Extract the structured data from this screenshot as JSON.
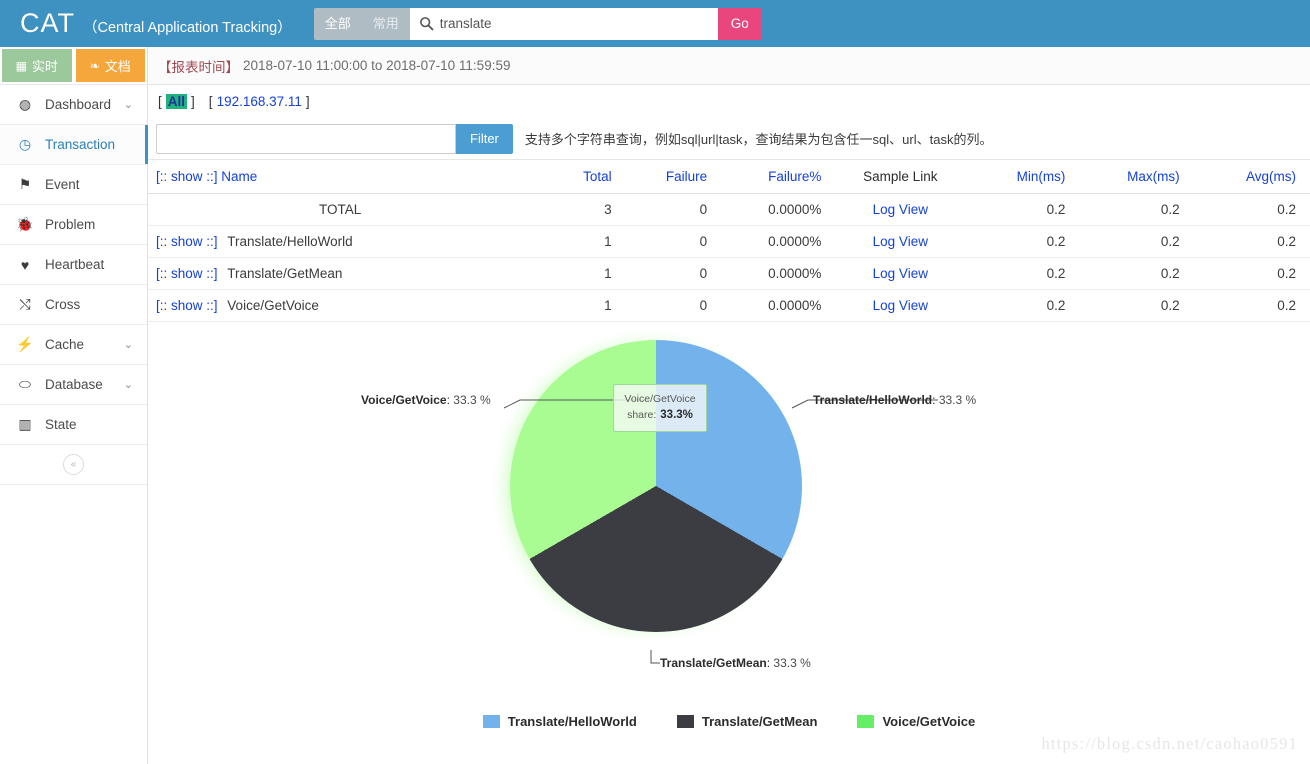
{
  "header": {
    "brand_main": "CAT",
    "brand_sub": "（Central Application Tracking）",
    "scope_all": "全部",
    "scope_common": "常用",
    "search_value": "translate",
    "search_placeholder": "",
    "go_label": "Go",
    "accent_color": "#3d92c2",
    "go_color": "#e8467c"
  },
  "sidebar": {
    "mode_live": "实时",
    "mode_doc": "文档",
    "collapse_label": "«",
    "items": [
      {
        "label": "Dashboard",
        "icon": "dashboard-icon",
        "glyph": "◍",
        "chevron": "⌄",
        "active": false
      },
      {
        "label": "Transaction",
        "icon": "clock-icon",
        "glyph": "◷",
        "chevron": "",
        "active": true
      },
      {
        "label": "Event",
        "icon": "flag-icon",
        "glyph": "⚑",
        "chevron": "",
        "active": false
      },
      {
        "label": "Problem",
        "icon": "bug-icon",
        "glyph": "⛏",
        "chevron": "",
        "active": false
      },
      {
        "label": "Heartbeat",
        "icon": "heart-icon",
        "glyph": "♥",
        "chevron": "",
        "active": false
      },
      {
        "label": "Cross",
        "icon": "shuffle-icon",
        "glyph": "⤫",
        "chevron": "",
        "active": false
      },
      {
        "label": "Cache",
        "icon": "bolt-icon",
        "glyph": "⚡",
        "chevron": "⌄",
        "active": false
      },
      {
        "label": "Database",
        "icon": "database-icon",
        "glyph": "⬭",
        "chevron": "⌄",
        "active": false
      },
      {
        "label": "State",
        "icon": "barchart-icon",
        "glyph": "▥",
        "chevron": "",
        "active": false
      }
    ]
  },
  "report": {
    "time_label": "【报表时间】",
    "time_range": "2018-07-10 11:00:00 to 2018-07-10 11:59:59",
    "host_all": "All",
    "host_ip": "192.168.37.11",
    "bracket_open": "[",
    "bracket_close": "]"
  },
  "filter": {
    "value": "",
    "placeholder": "",
    "button_label": "Filter",
    "hint": "支持多个字符串查询，例如sql|url|task，查询结果为包含任一sql、url、task的列。"
  },
  "table": {
    "headers": [
      "[:: show ::] Name",
      "Total",
      "Failure",
      "Failure%",
      "Sample Link",
      "Min(ms)",
      "Max(ms)",
      "Avg(ms)"
    ],
    "show_label": "[:: show ::]",
    "log_label": "Log View",
    "rows": [
      {
        "show": "",
        "name": "TOTAL",
        "total": "3",
        "failure": "0",
        "failure_pct": "0.0000%",
        "sample": "Log View",
        "min": "0.2",
        "max": "0.2",
        "avg": "0.2",
        "is_total": true
      },
      {
        "show": "[:: show ::]",
        "name": "Translate/HelloWorld",
        "total": "1",
        "failure": "0",
        "failure_pct": "0.0000%",
        "sample": "Log View",
        "min": "0.2",
        "max": "0.2",
        "avg": "0.2",
        "is_total": false
      },
      {
        "show": "[:: show ::]",
        "name": "Translate/GetMean",
        "total": "1",
        "failure": "0",
        "failure_pct": "0.0000%",
        "sample": "Log View",
        "min": "0.2",
        "max": "0.2",
        "avg": "0.2",
        "is_total": false
      },
      {
        "show": "[:: show ::]",
        "name": "Voice/GetVoice",
        "total": "1",
        "failure": "0",
        "failure_pct": "0.0000%",
        "sample": "Log View",
        "min": "0.2",
        "max": "0.2",
        "avg": "0.2",
        "is_total": false
      }
    ]
  },
  "chart_data": {
    "type": "pie",
    "title": "",
    "categories": [
      "Translate/HelloWorld",
      "Translate/GetMean",
      "Voice/GetVoice"
    ],
    "values": [
      33.3,
      33.3,
      33.3
    ],
    "unit": "%",
    "colors": [
      "#74b2ec",
      "#3b3d42",
      "#a8fc92"
    ],
    "legend_position": "bottom",
    "labels": [
      {
        "name": "Translate/HelloWorld",
        "value": "33.3 %"
      },
      {
        "name": "Translate/GetMean",
        "value": "33.3 %"
      },
      {
        "name": "Voice/GetVoice",
        "value": "33.3 %"
      }
    ],
    "tooltip": {
      "name": "Voice/GetVoice",
      "metric": "share:",
      "value": "33.3%"
    }
  },
  "watermark": "https://blog.csdn.net/caohao0591"
}
